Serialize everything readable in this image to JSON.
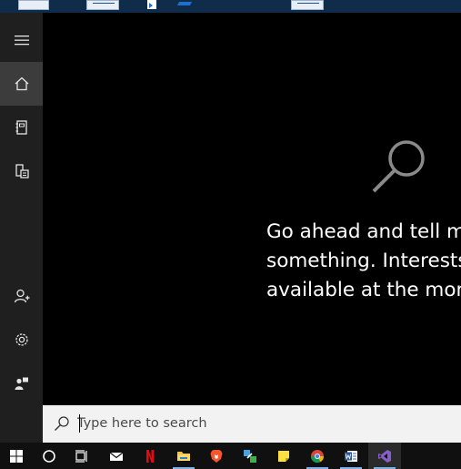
{
  "sidebar": {
    "items": [
      {
        "icon": "menu-icon"
      },
      {
        "icon": "home-icon"
      },
      {
        "icon": "notebook-icon"
      },
      {
        "icon": "devices-icon"
      },
      {
        "icon": "add-user-icon"
      },
      {
        "icon": "settings-icon"
      },
      {
        "icon": "feedback-icon"
      }
    ]
  },
  "main": {
    "message": "Go ahead and tell m\nsomething. Interests\navailable at the mom"
  },
  "search": {
    "placeholder": "Type here to search"
  },
  "taskbar": {
    "items": [
      {
        "icon": "windows-start-icon"
      },
      {
        "icon": "cortana-icon"
      },
      {
        "icon": "task-view-icon"
      },
      {
        "icon": "mail-icon"
      },
      {
        "icon": "netflix-icon"
      },
      {
        "icon": "file-explorer-icon"
      },
      {
        "icon": "brave-browser-icon"
      },
      {
        "icon": "network-app-icon"
      },
      {
        "icon": "sticky-notes-icon"
      },
      {
        "icon": "chrome-icon"
      },
      {
        "icon": "word-icon"
      },
      {
        "icon": "visual-studio-icon"
      }
    ]
  },
  "colors": {
    "sidebar_bg": "#1f1f1f",
    "active_bg": "#3c3c3c",
    "taskbar_bg": "#101010",
    "search_bg": "#f2f2f2",
    "accent": "#7fb2e8"
  }
}
